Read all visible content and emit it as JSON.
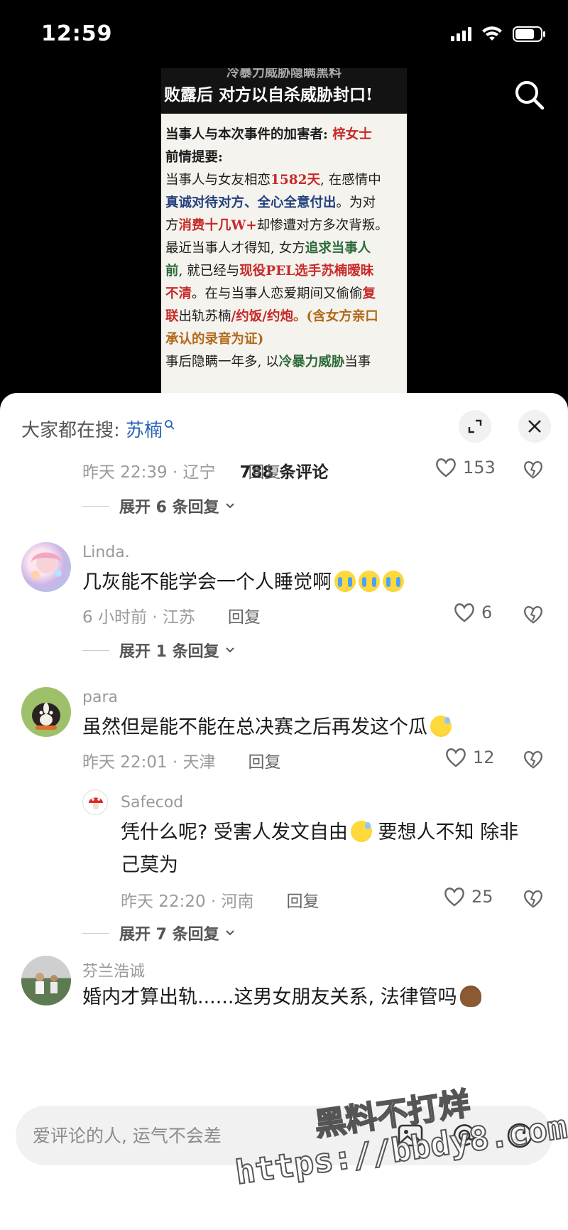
{
  "status_bar": {
    "time": "12:59"
  },
  "video": {
    "banner_top": "冷暴力威胁隐瞒黑料",
    "banner_main": "败露后 对方以自杀威胁封口!",
    "lines": [
      {
        "parts": [
          {
            "t": "当事人与本次事件的加害者: ",
            "c": "bold"
          },
          {
            "t": "梓女士",
            "c": "red"
          }
        ]
      },
      {
        "parts": [
          {
            "t": "前情提要:",
            "c": "bold"
          }
        ]
      },
      {
        "parts": [
          {
            "t": "  当事人与女友相恋",
            "c": ""
          },
          {
            "t": "1582天",
            "c": "red"
          },
          {
            "t": ", 在感情中",
            "c": ""
          }
        ]
      },
      {
        "parts": [
          {
            "t": "真诚对待对方、全心全意付出",
            "c": "blue"
          },
          {
            "t": "。为对",
            "c": ""
          }
        ]
      },
      {
        "parts": [
          {
            "t": "方",
            "c": ""
          },
          {
            "t": "消费十几W+",
            "c": "red"
          },
          {
            "t": "却惨遭对方多次背叛。",
            "c": ""
          }
        ]
      },
      {
        "parts": [
          {
            "t": "  最近当事人才得知, 女方",
            "c": ""
          },
          {
            "t": "追求当事人",
            "c": "green"
          }
        ]
      },
      {
        "parts": [
          {
            "t": "前",
            "c": "green"
          },
          {
            "t": ", 就已经与",
            "c": ""
          },
          {
            "t": "现役PEL选手苏楠暧昧",
            "c": "red"
          }
        ]
      },
      {
        "parts": [
          {
            "t": "不清",
            "c": "red"
          },
          {
            "t": "。在与当事人恋爱期间又偷偷",
            "c": ""
          },
          {
            "t": "复",
            "c": "red"
          }
        ]
      },
      {
        "parts": [
          {
            "t": "联",
            "c": "red"
          },
          {
            "t": "出轨苏楠",
            "c": ""
          },
          {
            "t": "/约饭/约炮",
            "c": "red"
          },
          {
            "t": "。(含女方亲口",
            "c": "orange"
          }
        ]
      },
      {
        "parts": [
          {
            "t": "承认的录音为证)",
            "c": "orange"
          }
        ]
      },
      {
        "parts": [
          {
            "t": "  事后隐瞒一年多, 以",
            "c": ""
          },
          {
            "t": "冷暴力威胁",
            "c": "green"
          },
          {
            "t": "当事",
            "c": ""
          }
        ]
      }
    ]
  },
  "sheet": {
    "trending_prefix": "大家都在搜: ",
    "trending_term": "苏楠",
    "comment_count": "788 条评论"
  },
  "comments": {
    "c0": {
      "meta": "昨天 22:39 · 辽宁",
      "reply": "回复",
      "likes": "153",
      "expand": "展开 6 条回复"
    },
    "c1": {
      "user": "Linda.",
      "text": "几灰能不能学会一个人睡觉啊",
      "meta": "6 小时前 · 江苏",
      "reply": "回复",
      "likes": "6",
      "expand": "展开 1 条回复"
    },
    "c2": {
      "user": "para",
      "text": "虽然但是能不能在总决赛之后再发这个瓜",
      "meta": "昨天 22:01 · 天津",
      "reply": "回复",
      "likes": "12"
    },
    "c2r": {
      "user": "Safecod",
      "text_line1": "凭什么呢? 受害人发文自由",
      "text_line1b": " 要想人不知 除非",
      "text_line2": "己莫为",
      "meta": "昨天 22:20 · 河南",
      "reply": "回复",
      "likes": "25",
      "expand": "展开 7 条回复"
    },
    "c3": {
      "user": "芬兰浩诚",
      "text": "婚内才算出轨......这男女朋友关系, 法律管吗"
    }
  },
  "input": {
    "placeholder": "爱评论的人, 运气不会差"
  },
  "watermark": {
    "line1": "黑料不打烊",
    "line2": "https://bbdy8.com"
  }
}
